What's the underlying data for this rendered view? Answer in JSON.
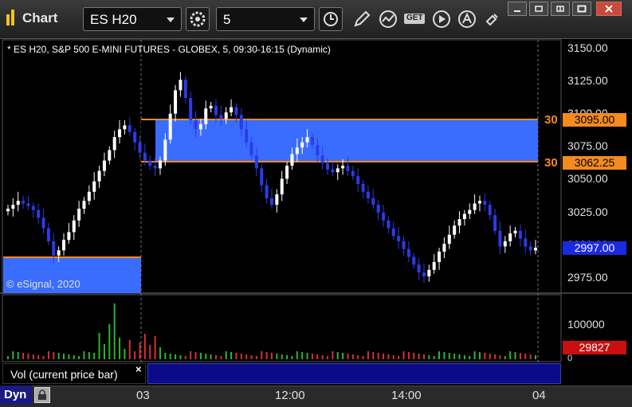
{
  "window": {
    "title": "Chart"
  },
  "toolbar": {
    "symbol": "ES H20",
    "interval": "5",
    "get_label": "GET"
  },
  "chart": {
    "header": "* ES H20, S&P 500 E-MINI FUTURES - GLOBEX, 5, 09:30-16:15 (Dynamic)",
    "copyright": "© eSignal, 2020",
    "price_axis": [
      "3150.00",
      "3125.00",
      "3100.00",
      "3075.00",
      "3050.00",
      "3025.00",
      "3000.00",
      "2975.00"
    ],
    "level_high": {
      "tag": "30",
      "price": "3095.00"
    },
    "level_low": {
      "tag": "30",
      "price": "3062.25"
    },
    "last_price": "2997.00",
    "colors": {
      "up": "#ffffff",
      "down": "#2a3ce8",
      "zone": "#3a6cff",
      "level": "#f58a1f",
      "volume_up": "#2ab82a",
      "volume_down": "#d83030"
    }
  },
  "volume": {
    "title": "Vol (current price bar)",
    "close_icon": "×",
    "axis": [
      "100000",
      "0"
    ],
    "last_volume": "29827"
  },
  "time_axis": [
    "03",
    "12:00",
    "14:00",
    "04"
  ],
  "status": {
    "mode": "Dyn"
  },
  "chart_data": {
    "type": "candlestick",
    "instrument": "ES H20",
    "interval": "5",
    "ylim": [
      2965,
      3160
    ],
    "levels": [
      3095.0,
      3062.25
    ],
    "last": 2997.0,
    "x_ticks": [
      "03",
      "12:00",
      "14:00",
      "04"
    ],
    "close": [
      3027,
      3030,
      3033,
      3031,
      3029,
      3026,
      3020,
      3012,
      3002,
      2991,
      2995,
      3003,
      3009,
      3018,
      3027,
      3033,
      3040,
      3048,
      3056,
      3064,
      3072,
      3082,
      3088,
      3091,
      3086,
      3078,
      3070,
      3064,
      3060,
      3058,
      3064,
      3080,
      3100,
      3118,
      3126,
      3112,
      3095,
      3088,
      3092,
      3104,
      3106,
      3099,
      3096,
      3101,
      3105,
      3099,
      3088,
      3078,
      3068,
      3058,
      3045,
      3035,
      3030,
      3038,
      3050,
      3060,
      3069,
      3074,
      3078,
      3082,
      3076,
      3068,
      3062,
      3057,
      3055,
      3058,
      3060,
      3056,
      3052,
      3046,
      3040,
      3035,
      3030,
      3024,
      3018,
      3012,
      3006,
      3002,
      2996,
      2990,
      2984,
      2978,
      2975,
      2980,
      2986,
      2994,
      3000,
      3007,
      3014,
      3019,
      3023,
      3026,
      3031,
      3033,
      3030,
      3022,
      3010,
      2998,
      3002,
      3008,
      3010,
      3004,
      2998,
      2995,
      2997
    ]
  }
}
